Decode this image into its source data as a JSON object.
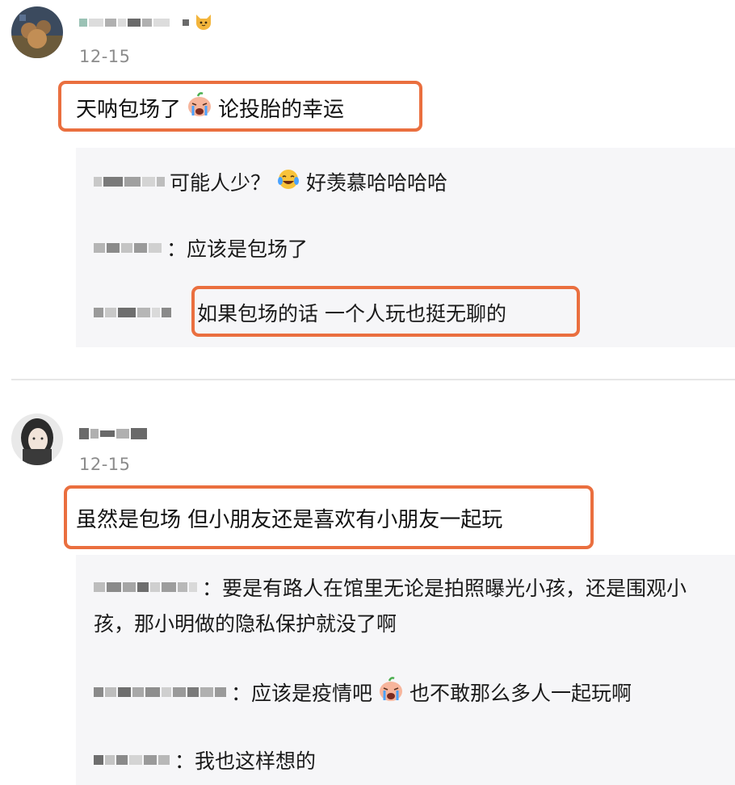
{
  "comments": [
    {
      "date": "12-15",
      "text_before": "天呐包场了",
      "text_after": "论投胎的幸运",
      "emoji": "crying-peach-emoji",
      "replies": [
        {
          "sep": "",
          "text": "可能人少？",
          "emoji": "tears-of-joy-emoji",
          "text_after": "好羡慕哈哈哈哈"
        },
        {
          "sep": "：",
          "text": "应该是包场了"
        },
        {
          "sep": "",
          "text": "如果包场的话 一个人玩也挺无聊的"
        }
      ]
    },
    {
      "date": "12-15",
      "text": "虽然是包场 但小朋友还是喜欢有小朋友一起玩",
      "replies": [
        {
          "sep": "：",
          "text_line1": "要是有路人在馆里无论是拍照曝光小孩，还是围观小",
          "text_line2": "孩，那小明做的隐私保护就没了啊"
        },
        {
          "sep": "：",
          "text": "应该是疫情吧",
          "emoji": "crying-peach-emoji",
          "text_after": "也不敢那么多人一起玩啊"
        },
        {
          "sep": "：",
          "text": "我也这样想的"
        }
      ]
    }
  ],
  "colors": {
    "highlight": "#ea6f3f",
    "reply_bg": "#f6f6f8",
    "date": "#8c8c8c"
  }
}
